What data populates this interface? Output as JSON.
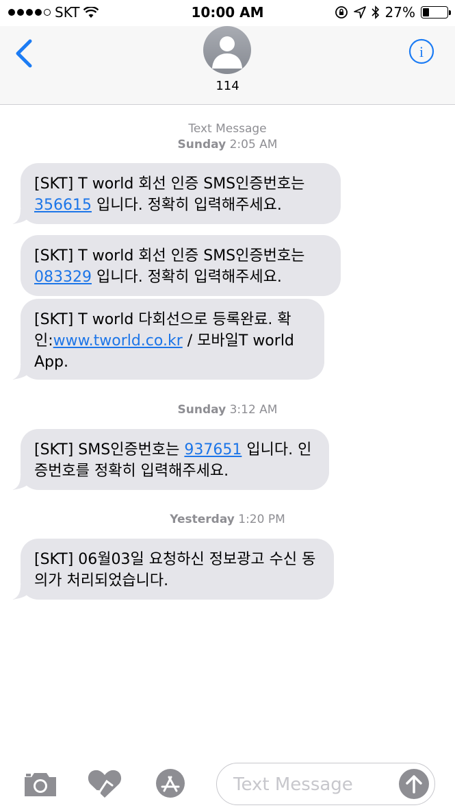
{
  "status_bar": {
    "carrier": "SKT",
    "time": "10:00 AM",
    "battery_text": "27%",
    "battery_level": 0.27
  },
  "header": {
    "contact_name": "114"
  },
  "conversation": {
    "header_label": "Text Message",
    "groups": [
      {
        "day": "Sunday",
        "time": "2:05 AM",
        "messages": [
          {
            "before": "[SKT] T world 회선 인증 SMS인증번호는 ",
            "link": "356615",
            "after": " 입니다. 정확히 입력해주세요."
          },
          {
            "before": "[SKT] T world 회선 인증 SMS인증번호는 ",
            "link": "083329",
            "after": " 입니다. 정확히 입력해주세요."
          },
          {
            "before": "[SKT] T world 다회선으로 등록완료. 확인:",
            "link": "www.tworld.co.kr",
            "after": " / 모바일T world App."
          }
        ]
      },
      {
        "day": "Sunday",
        "time": "3:12 AM",
        "messages": [
          {
            "before": "[SKT] SMS인증번호는 ",
            "link": "937651",
            "after": " 입니다. 인증번호를 정확히 입력해주세요."
          }
        ]
      },
      {
        "day": "Yesterday",
        "time": "1:20 PM",
        "messages": [
          {
            "text": "[SKT] 06월03일 요청하신 정보광고 수신 동의가 처리되었습니다."
          }
        ]
      }
    ]
  },
  "input_bar": {
    "placeholder": "Text Message",
    "icons": [
      "camera-icon",
      "digital-touch-icon",
      "app-store-icon",
      "send-icon"
    ]
  }
}
